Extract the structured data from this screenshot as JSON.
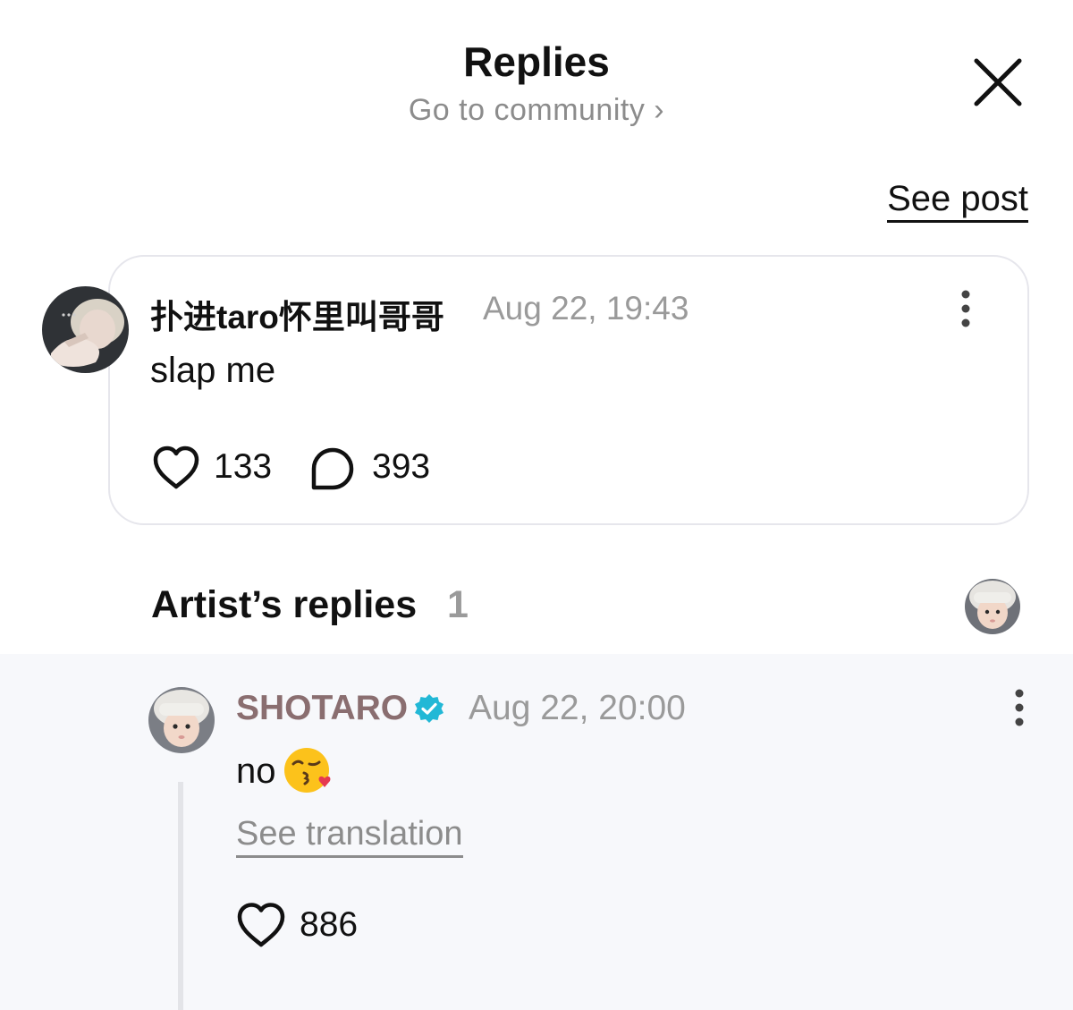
{
  "header": {
    "title": "Replies",
    "community_link": "Go to community",
    "community_chevron": "›",
    "close_icon": "close-icon"
  },
  "see_post_label": "See post",
  "post": {
    "username": "扑进taro怀里叫哥哥",
    "timestamp": "Aug 22, 19:43",
    "text": "slap me",
    "like_count": "133",
    "comment_count": "393",
    "icons": [
      "heart-icon",
      "comment-bubble-icon",
      "more-vertical-icon"
    ]
  },
  "artist_replies": {
    "heading": "Artist’s replies",
    "count": "1",
    "reply": {
      "username": "SHOTARO",
      "verified": true,
      "timestamp": "Aug 22, 20:00",
      "text": "no",
      "emoji": "😘",
      "see_translation": "See translation",
      "like_count": "886"
    }
  },
  "colors": {
    "primary_text": "#111111",
    "muted_text": "#9a9a9a",
    "artist_name": "#8a6e70",
    "verified_badge": "#22b8d6",
    "reply_background": "#f7f8fb",
    "card_border": "#e6e6ec"
  }
}
